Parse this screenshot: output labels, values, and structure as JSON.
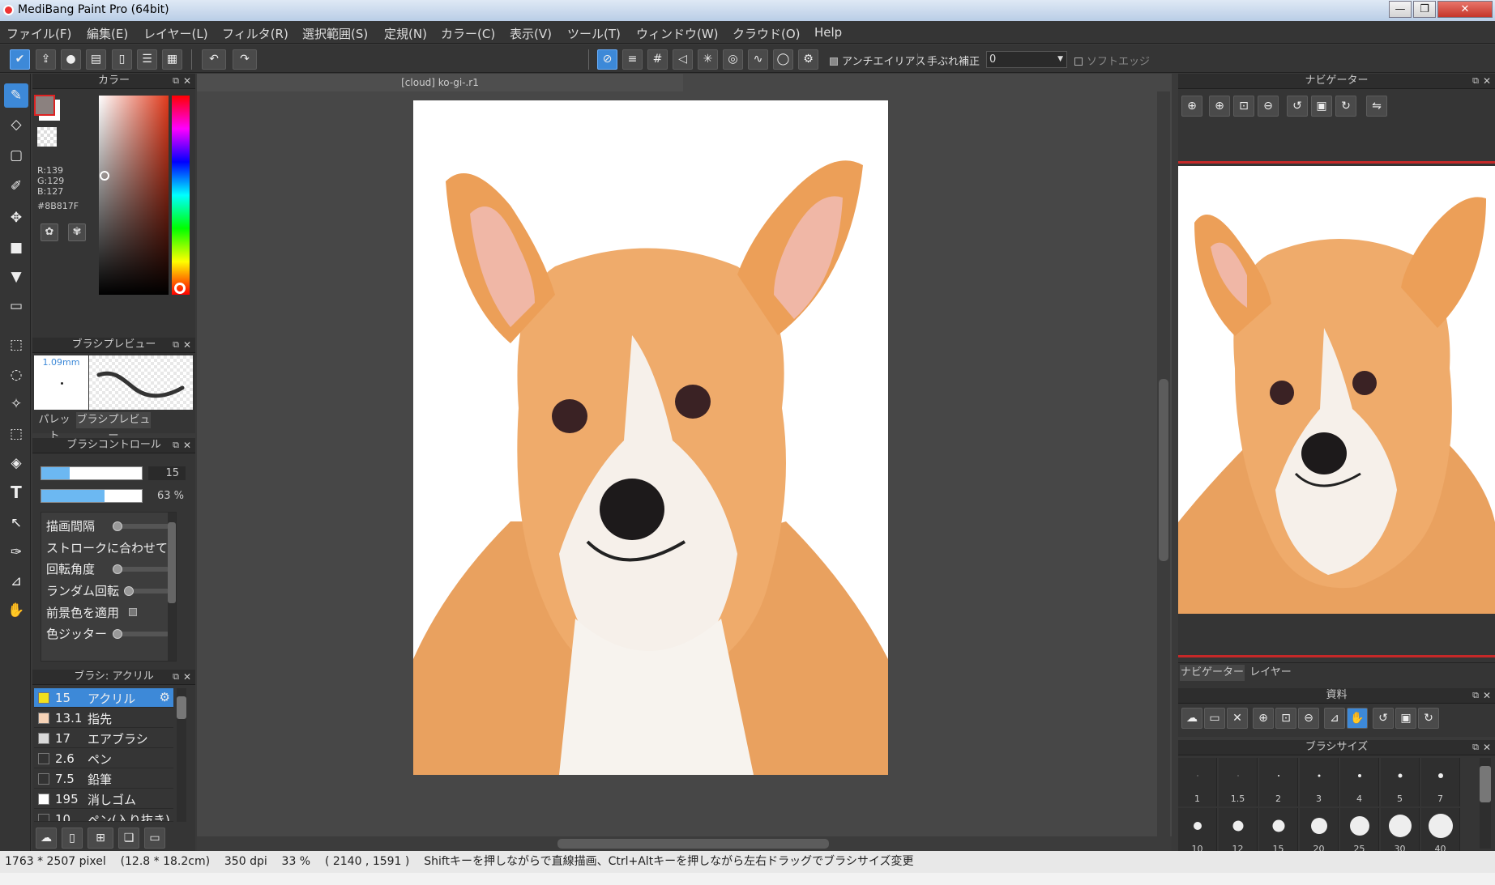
{
  "window": {
    "title": "MediBang Paint Pro (64bit)",
    "controls": [
      "—",
      "❐",
      "✕"
    ]
  },
  "menu": [
    "ファイル(F)",
    "編集(E)",
    "レイヤー(L)",
    "フィルタ(R)",
    "選択範囲(S)",
    "定規(N)",
    "カラー(C)",
    "表示(V)",
    "ツール(T)",
    "ウィンドウ(W)",
    "クラウド(O)",
    "Help"
  ],
  "toolbar": {
    "left_icons": [
      "cloud-sync-icon",
      "share-icon",
      "speech-icon",
      "comment-icon",
      "page-icon",
      "list-icon",
      "grid-icon"
    ],
    "undo": "↶",
    "redo": "↷",
    "antialias_label": "アンチエイリアス",
    "stabilizer_label": "手ぶれ補正",
    "stabilizer_value": "0",
    "soft_edge_label": "ソフトエッジ"
  },
  "color_panel": {
    "title": "カラー",
    "r": "R:139",
    "g": "G:129",
    "b": "B:127",
    "hex": "#8B817F",
    "current_color": "#8B817F"
  },
  "brush_preview": {
    "title": "ブラシプレビュー",
    "size": "1.09mm",
    "tab_palette": "パレット",
    "tab_preview": "ブラシプレビュー"
  },
  "brush_control": {
    "title": "ブラシコントロール",
    "size_value": "15",
    "opacity_value": "63 %",
    "rows": [
      "描画間隔",
      "ストロークに合わせて回転",
      "回転角度",
      "ランダム回転",
      "前景色を適用",
      "色ジッター"
    ]
  },
  "brush_list": {
    "title": "ブラシ: アクリル",
    "items": [
      {
        "size": "15",
        "name": "アクリル",
        "color": "#f2e01c"
      },
      {
        "size": "13.1",
        "name": "指先",
        "color": "#f6d3b7"
      },
      {
        "size": "17",
        "name": "エアブラシ",
        "color": "#d9d9d9"
      },
      {
        "size": "2.6",
        "name": "ペン",
        "color": "#333333"
      },
      {
        "size": "7.5",
        "name": "鉛筆",
        "color": "#333333"
      },
      {
        "size": "195",
        "name": "消しゴム",
        "color": "#ffffff"
      },
      {
        "size": "10",
        "name": "ペン(入り抜き)",
        "color": "#333333"
      }
    ]
  },
  "document": {
    "tab": "[cloud] ko-gi-.r1"
  },
  "navigator": {
    "title": "ナビゲーター",
    "tab_navigator": "ナビゲーター",
    "tab_layer": "レイヤー"
  },
  "material": {
    "title": "資料"
  },
  "brush_size_panel": {
    "title": "ブラシサイズ",
    "row1": [
      "1",
      "1.5",
      "2",
      "3",
      "4",
      "5",
      "7"
    ],
    "row2": [
      "10",
      "12",
      "15",
      "20",
      "25",
      "30",
      "40"
    ]
  },
  "status": {
    "pixels": "1763 * 2507 pixel",
    "cm": "(12.8 * 18.2cm)",
    "dpi": "350 dpi",
    "zoom": "33 %",
    "coords": "( 2140 , 1591 )",
    "hint": "Shiftキーを押しながらで直線描画、Ctrl+Altキーを押しながら左右ドラッグでブラシサイズ変更"
  }
}
